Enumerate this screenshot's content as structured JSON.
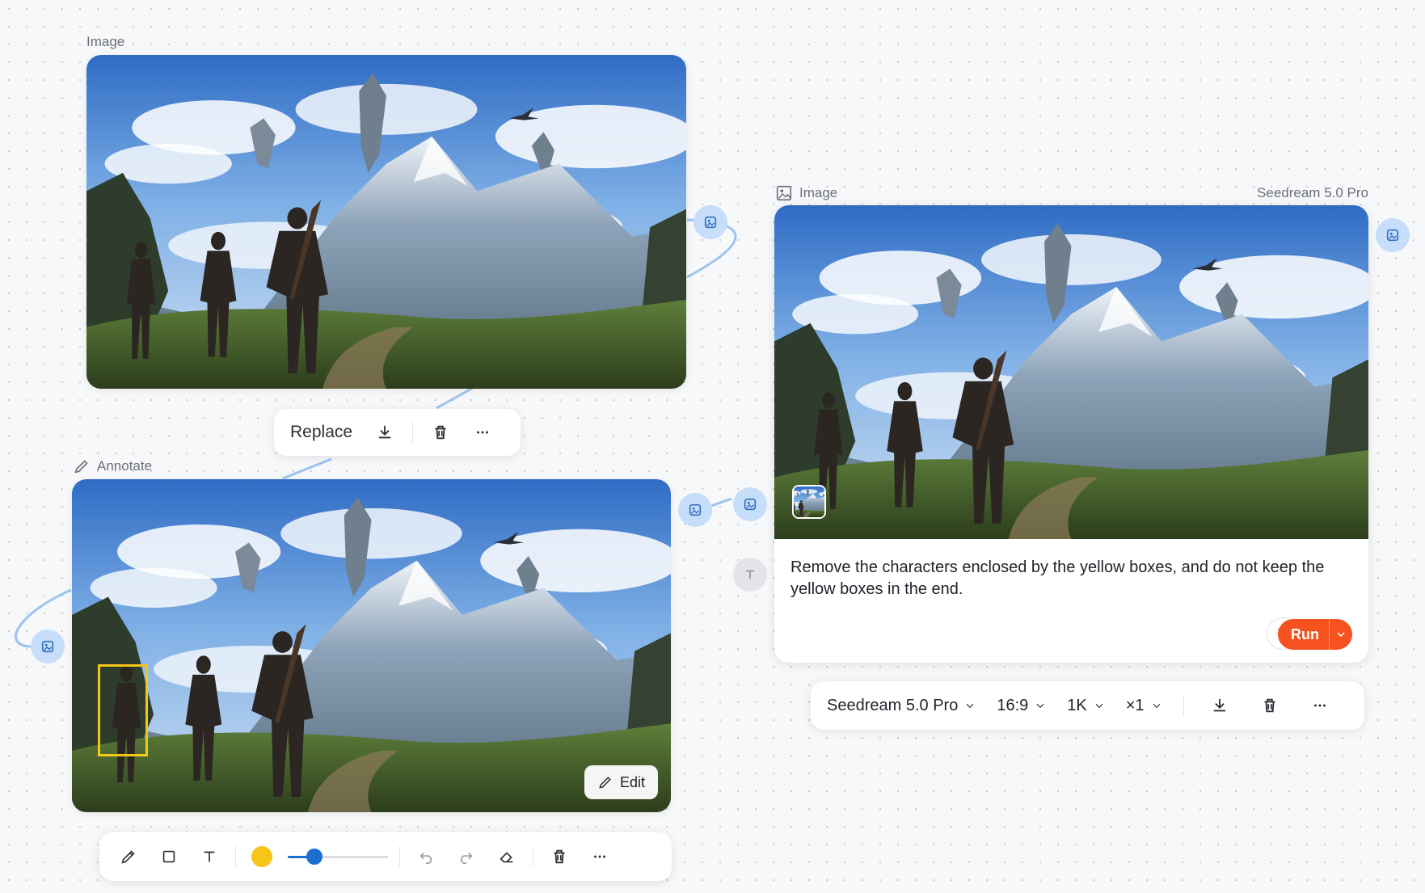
{
  "top_node": {
    "label": "Image"
  },
  "image_toolbar": {
    "replace_label": "Replace"
  },
  "annotate_node": {
    "label": "Annotate",
    "edit_label": "Edit"
  },
  "annotate_toolbar": {
    "color": "#f5c518",
    "brush_size_fraction": 0.22
  },
  "result_node": {
    "label": "Image",
    "model_tag": "Seedream 5.0 Pro",
    "prompt": "Remove the characters enclosed by the yellow boxes, and do not keep the yellow boxes in the end.",
    "run_label": "Run",
    "run_color": "#f5521f"
  },
  "gen_toolbar": {
    "model": "Seedream 5.0 Pro",
    "aspect": "16:9",
    "resolution": "1K",
    "count": "×1"
  },
  "colors": {
    "port": "#c6defa",
    "port_icon": "#2f6fbd",
    "annotation_box": "#f5c518",
    "slider": "#1b6fd1"
  }
}
